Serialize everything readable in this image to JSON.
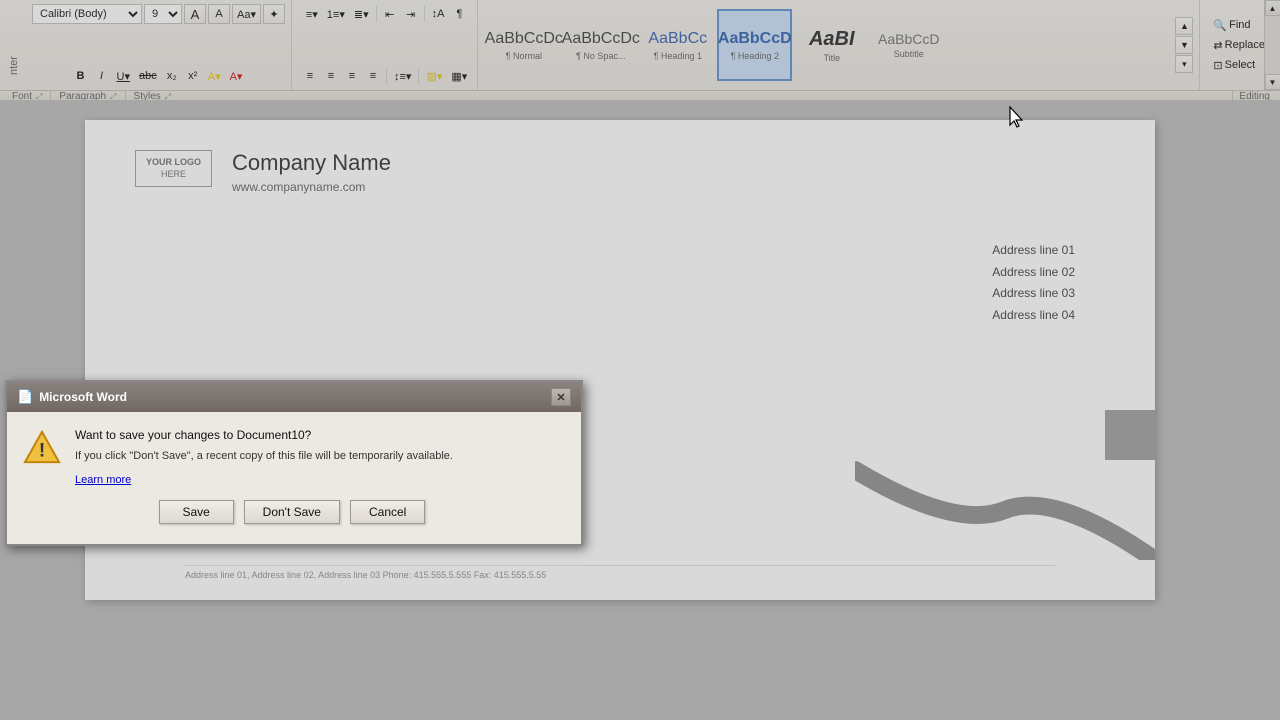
{
  "ribbon": {
    "font_name": "Calibri (Body)",
    "font_size": "9",
    "groups": {
      "font_label": "Font",
      "paragraph_label": "Paragraph",
      "styles_label": "Styles",
      "editing_label": "Editing"
    },
    "formatting": {
      "bold": "B",
      "italic": "I",
      "underline": "U",
      "strikethrough": "abc",
      "subscript": "x₂",
      "superscript": "x²"
    },
    "styles": [
      {
        "id": "normal",
        "preview": "AaBbCcDc",
        "label": "¶ Normal"
      },
      {
        "id": "no-spacing",
        "preview": "AaBbCcDc",
        "label": "¶ No Spac..."
      },
      {
        "id": "heading1",
        "preview": "AaBbCc",
        "label": "¶ Heading 1"
      },
      {
        "id": "heading2",
        "preview": "AaBbCcD",
        "label": "¶ Heading 2",
        "active": true
      },
      {
        "id": "title",
        "preview": "AaBI",
        "label": "Title"
      },
      {
        "id": "subtitle",
        "preview": "AaBbCcD",
        "label": "Subtitle"
      }
    ],
    "editing_buttons": [
      "Find",
      "Replace",
      "Select"
    ]
  },
  "document": {
    "logo_line1": "YOUR LOGO",
    "logo_line2": "HERE",
    "company_name": "Company Name",
    "company_url": "www.companyname.com",
    "address_lines": [
      "Address line 01",
      "Address line 02",
      "Address line 03",
      "Address line 04"
    ],
    "footer_text": "Address line 01, Address line 02, Address line 03  Phone: 415.555.5.555  Fax: 415.555.5.55"
  },
  "dialog": {
    "title": "Microsoft Word",
    "close_btn": "✕",
    "main_message": "Want to save your changes to Document10?",
    "sub_message": "If you click \"Don't Save\", a recent copy of this file will be temporarily available.",
    "learn_more": "Learn more",
    "buttons": {
      "save": "Save",
      "dont_save": "Don't Save",
      "cancel": "Cancel"
    }
  }
}
